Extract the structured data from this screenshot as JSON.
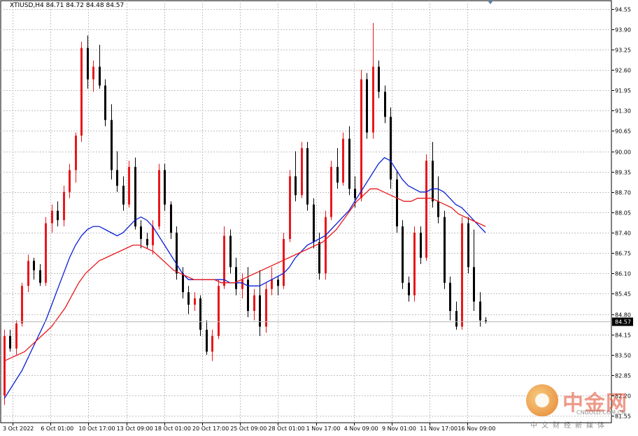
{
  "header": {
    "symbol_info": "XTIUSD,H4  84.71 84.72 84.48 84.57"
  },
  "chart_data": {
    "type": "candlestick",
    "symbol": "XTIUSD",
    "timeframe": "H4",
    "ohlc_header": {
      "open": 84.71,
      "high": 84.72,
      "low": 84.48,
      "close": 84.57
    },
    "current_price": 84.57,
    "current_price_label": "84.57",
    "ylim": [
      81.33,
      94.81
    ],
    "y_ticks": [
      "94.55",
      "93.90",
      "93.25",
      "92.60",
      "91.95",
      "91.30",
      "90.65",
      "90.00",
      "89.35",
      "88.70",
      "88.05",
      "87.40",
      "86.75",
      "86.10",
      "85.45",
      "84.80",
      "84.15",
      "83.50",
      "82.85",
      "82.20",
      "81.55"
    ],
    "x_ticks": [
      "3 Oct 2022",
      "6 Oct 01:00",
      "10 Oct 17:00",
      "13 Oct 09:00",
      "18 Oct 01:00",
      "20 Oct 17:00",
      "25 Oct 09:00",
      "28 Oct 01:00",
      "1 Nov 17:00",
      "4 Nov 09:00",
      "9 Nov 01:00",
      "11 Nov 17:00",
      "16 Nov 09:00"
    ],
    "grid": true,
    "up_color": "#e8171b",
    "down_color": "#000000",
    "candles": [
      [
        82.2,
        84.3,
        81.9,
        84.1
      ],
      [
        84.1,
        84.3,
        83.6,
        83.7
      ],
      [
        83.7,
        84.6,
        83.5,
        84.5
      ],
      [
        84.5,
        85.8,
        84.4,
        85.7
      ],
      [
        85.7,
        86.7,
        85.5,
        86.5
      ],
      [
        86.5,
        86.6,
        85.9,
        86.2
      ],
      [
        86.2,
        86.4,
        85.7,
        85.8
      ],
      [
        85.8,
        87.9,
        85.7,
        87.7
      ],
      [
        87.7,
        88.3,
        87.4,
        88.1
      ],
      [
        88.1,
        88.4,
        87.6,
        87.8
      ],
      [
        87.8,
        88.9,
        87.6,
        88.7
      ],
      [
        88.7,
        89.6,
        88.5,
        89.4
      ],
      [
        89.4,
        90.6,
        89.0,
        90.5
      ],
      [
        90.5,
        93.5,
        90.3,
        93.3
      ],
      [
        93.3,
        93.7,
        92.0,
        92.3
      ],
      [
        92.3,
        92.9,
        91.9,
        92.7
      ],
      [
        92.7,
        93.4,
        92.0,
        92.1
      ],
      [
        92.1,
        92.3,
        90.8,
        91.0
      ],
      [
        91.0,
        91.5,
        89.1,
        89.4
      ],
      [
        89.4,
        90.0,
        88.7,
        88.9
      ],
      [
        88.9,
        89.2,
        88.1,
        88.3
      ],
      [
        88.3,
        89.7,
        88.2,
        89.5
      ],
      [
        89.5,
        89.8,
        87.5,
        87.6
      ],
      [
        87.6,
        87.8,
        86.9,
        87.2
      ],
      [
        87.2,
        87.4,
        86.9,
        87.0
      ],
      [
        87.0,
        87.8,
        86.7,
        87.6
      ],
      [
        87.6,
        89.6,
        87.5,
        89.4
      ],
      [
        89.4,
        89.6,
        88.1,
        88.3
      ],
      [
        88.3,
        88.4,
        87.2,
        87.4
      ],
      [
        87.4,
        87.6,
        85.9,
        86.1
      ],
      [
        86.1,
        86.3,
        85.3,
        85.5
      ],
      [
        85.5,
        85.7,
        84.8,
        85.1
      ],
      [
        85.1,
        85.5,
        84.9,
        85.3
      ],
      [
        85.3,
        85.4,
        84.1,
        84.3
      ],
      [
        84.3,
        84.6,
        83.5,
        83.6
      ],
      [
        83.6,
        84.3,
        83.3,
        84.1
      ],
      [
        84.1,
        85.9,
        84.0,
        85.7
      ],
      [
        85.7,
        87.6,
        85.6,
        87.3
      ],
      [
        87.3,
        87.5,
        86.1,
        86.3
      ],
      [
        86.3,
        86.6,
        85.4,
        85.6
      ],
      [
        85.6,
        86.1,
        85.3,
        85.9
      ],
      [
        85.9,
        86.3,
        84.7,
        84.9
      ],
      [
        84.9,
        85.6,
        84.6,
        85.4
      ],
      [
        85.4,
        86.2,
        84.1,
        84.4
      ],
      [
        84.4,
        85.8,
        84.2,
        85.6
      ],
      [
        85.6,
        86.3,
        85.4,
        85.9
      ],
      [
        85.9,
        86.0,
        85.4,
        85.7
      ],
      [
        85.7,
        87.4,
        85.6,
        87.2
      ],
      [
        87.2,
        89.4,
        87.1,
        89.2
      ],
      [
        89.2,
        90.0,
        88.4,
        88.6
      ],
      [
        88.6,
        90.3,
        88.5,
        90.1
      ],
      [
        90.1,
        90.3,
        88.1,
        88.3
      ],
      [
        88.3,
        88.5,
        86.9,
        87.1
      ],
      [
        87.1,
        87.4,
        85.9,
        86.1
      ],
      [
        86.1,
        88.1,
        85.9,
        87.9
      ],
      [
        87.9,
        89.7,
        87.8,
        89.5
      ],
      [
        89.5,
        90.1,
        88.8,
        89.0
      ],
      [
        89.0,
        90.6,
        88.9,
        90.4
      ],
      [
        90.4,
        90.8,
        88.6,
        88.8
      ],
      [
        88.8,
        89.2,
        88.2,
        88.5
      ],
      [
        88.5,
        92.6,
        88.4,
        92.3
      ],
      [
        92.3,
        92.5,
        90.4,
        90.6
      ],
      [
        90.6,
        94.1,
        90.4,
        92.7
      ],
      [
        92.7,
        92.9,
        91.7,
        91.9
      ],
      [
        91.9,
        92.1,
        90.9,
        91.1
      ],
      [
        91.1,
        91.4,
        88.8,
        89.1
      ],
      [
        89.1,
        89.4,
        87.4,
        87.6
      ],
      [
        87.6,
        87.8,
        85.6,
        85.8
      ],
      [
        85.8,
        86.0,
        85.2,
        85.4
      ],
      [
        85.4,
        87.6,
        85.2,
        87.4
      ],
      [
        87.4,
        87.6,
        86.4,
        86.6
      ],
      [
        86.6,
        89.9,
        86.5,
        89.7
      ],
      [
        89.7,
        90.3,
        88.2,
        88.4
      ],
      [
        88.4,
        89.2,
        87.7,
        87.9
      ],
      [
        87.9,
        88.1,
        85.6,
        85.8
      ],
      [
        85.8,
        86.0,
        84.6,
        84.9
      ],
      [
        84.9,
        85.2,
        84.3,
        84.4
      ],
      [
        84.4,
        87.9,
        84.3,
        87.7
      ],
      [
        87.7,
        87.9,
        86.1,
        86.3
      ],
      [
        86.3,
        87.5,
        84.9,
        85.2
      ],
      [
        85.2,
        85.5,
        84.4,
        84.6
      ],
      [
        84.6,
        84.7,
        84.5,
        84.57
      ]
    ],
    "series": [
      {
        "name": "",
        "color": "#0a1fd6",
        "values": [
          82.1,
          82.4,
          82.7,
          83.0,
          83.4,
          83.8,
          84.2,
          84.6,
          85.1,
          85.6,
          86.1,
          86.6,
          87.0,
          87.3,
          87.5,
          87.6,
          87.6,
          87.5,
          87.4,
          87.3,
          87.4,
          87.6,
          87.8,
          87.9,
          87.8,
          87.6,
          87.3,
          87.0,
          86.7,
          86.4,
          86.1,
          85.9,
          85.9,
          85.9,
          85.9,
          85.9,
          85.9,
          85.9,
          85.8,
          85.8,
          85.8,
          85.7,
          85.7,
          85.7,
          85.8,
          85.9,
          86.0,
          86.1,
          86.3,
          86.6,
          86.8,
          87.0,
          87.1,
          87.2,
          87.3,
          87.5,
          87.7,
          87.9,
          88.1,
          88.4,
          88.7,
          89.0,
          89.3,
          89.6,
          89.8,
          89.7,
          89.4,
          89.1,
          88.9,
          88.8,
          88.7,
          88.7,
          88.8,
          88.8,
          88.7,
          88.5,
          88.3,
          88.2,
          88.0,
          87.8,
          87.6,
          87.4
        ]
      },
      {
        "name": "",
        "color": "#e8171b",
        "values": [
          83.3,
          83.4,
          83.5,
          83.6,
          83.8,
          84.0,
          84.2,
          84.4,
          84.7,
          85.0,
          85.4,
          85.8,
          86.1,
          86.3,
          86.5,
          86.6,
          86.7,
          86.8,
          86.9,
          87.0,
          87.0,
          86.9,
          86.8,
          86.6,
          86.4,
          86.2,
          86.1,
          86.0,
          85.9,
          85.9,
          85.9,
          85.9,
          85.8,
          85.8,
          85.8,
          85.9,
          86.0,
          86.1,
          86.2,
          86.3,
          86.4,
          86.5,
          86.6,
          86.7,
          86.8,
          86.9,
          87.0,
          87.1,
          87.3,
          87.5,
          87.8,
          88.1,
          88.4,
          88.6,
          88.8,
          88.8,
          88.7,
          88.6,
          88.5,
          88.4,
          88.4,
          88.5,
          88.5,
          88.5,
          88.4,
          88.3,
          88.2,
          88.0,
          87.9,
          87.8,
          87.7,
          87.6
        ]
      }
    ]
  },
  "watermark": {
    "title": "中金网",
    "domain": "CNGOLD.COM.CN",
    "subtitle": "中文财经新媒体"
  }
}
